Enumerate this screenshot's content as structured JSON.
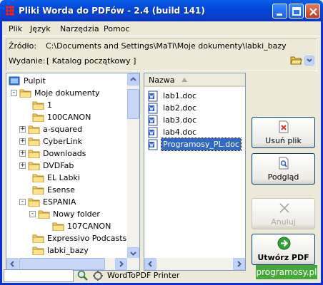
{
  "window": {
    "title": "Pliki Worda do PDFów - 2.4 (build 141)",
    "app_icon": "red-pdf-icon",
    "titlebar_color": "#0a4fdc"
  },
  "menu": [
    "Plik",
    "Język",
    "Narzędzia",
    "Pomoc"
  ],
  "source": {
    "label": "Źródło:",
    "path": "C:\\Documents and Settings\\MaTi\\Moje dokumenty\\labki_bazy"
  },
  "edition": {
    "label": "Wydanie:",
    "value": "[ Katalog początkowy ]"
  },
  "tree": [
    {
      "label": "Pulpit",
      "icon": "desktop-icon",
      "expander": ""
    },
    {
      "label": "Moje dokumenty",
      "icon": "documents-folder-icon",
      "expander": "-"
    },
    {
      "label": "1",
      "icon": "folder-icon",
      "expander": ""
    },
    {
      "label": "100CANON",
      "icon": "folder-icon",
      "expander": ""
    },
    {
      "label": "a-squared",
      "icon": "folder-icon",
      "expander": "+"
    },
    {
      "label": "CyberLink",
      "icon": "folder-icon",
      "expander": "+"
    },
    {
      "label": "Downloads",
      "icon": "folder-icon",
      "expander": "+"
    },
    {
      "label": "DVDFab",
      "icon": "folder-icon",
      "expander": "+"
    },
    {
      "label": "EL Labki",
      "icon": "folder-icon",
      "expander": ""
    },
    {
      "label": "Esense",
      "icon": "folder-icon",
      "expander": ""
    },
    {
      "label": "ESPANIA",
      "icon": "folder-icon",
      "expander": "-"
    },
    {
      "label": "Nowy folder",
      "icon": "folder-icon",
      "expander": "-"
    },
    {
      "label": "107CANON",
      "icon": "folder-icon",
      "expander": ""
    },
    {
      "label": "Expressivo Podcasts",
      "icon": "folder-icon",
      "expander": ""
    },
    {
      "label": "labki_bazy",
      "icon": "open-folder-icon",
      "expander": ""
    }
  ],
  "files": {
    "column": "Nazwa",
    "items": [
      "lab1.doc",
      "lab2.doc",
      "lab3.doc",
      "lab4.doc",
      "Programosy_PL.doc"
    ],
    "selected": "Programosy_PL.doc"
  },
  "buttons": {
    "remove": "Usuń plik",
    "preview": "Podgląd",
    "cancel": "Anuluj",
    "create": "Utwórz PDF"
  },
  "status": {
    "input_value": "",
    "printer": "WordToPDF Printer"
  },
  "watermark": "programosy.pl"
}
